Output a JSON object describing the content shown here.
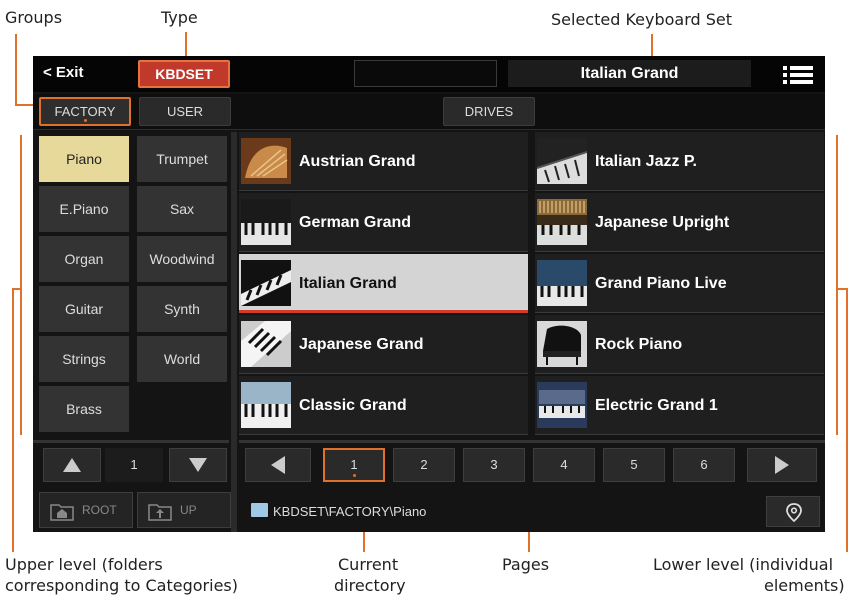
{
  "callouts": {
    "groups": "Groups",
    "type": "Type",
    "selected_set": "Selected Keyboard Set",
    "upper_level_1": "Upper level (folders",
    "upper_level_2": "corresponding to Categories)",
    "current_dir_1": "Current",
    "current_dir_2": "directory",
    "pages": "Pages",
    "lower_level_1": "Lower level (individual",
    "lower_level_2": "elements)"
  },
  "topbar": {
    "exit_label": "< Exit",
    "type_label": "KBDSET",
    "selected_set": "Italian Grand",
    "menu_icon": "hamburger-icon"
  },
  "groups": {
    "factory": "FACTORY",
    "user": "USER",
    "drives": "DRIVES"
  },
  "categories": [
    {
      "label": "Piano",
      "selected": true
    },
    {
      "label": "Trumpet"
    },
    {
      "label": "E.Piano"
    },
    {
      "label": "Sax"
    },
    {
      "label": "Organ"
    },
    {
      "label": "Woodwind"
    },
    {
      "label": "Guitar"
    },
    {
      "label": "Synth"
    },
    {
      "label": "Strings"
    },
    {
      "label": "World"
    },
    {
      "label": "Brass"
    }
  ],
  "elements": [
    {
      "label": "Austrian Grand"
    },
    {
      "label": "Italian Jazz P."
    },
    {
      "label": "German Grand"
    },
    {
      "label": "Japanese Upright"
    },
    {
      "label": "Italian Grand",
      "selected": true
    },
    {
      "label": "Grand Piano Live"
    },
    {
      "label": "Japanese Grand"
    },
    {
      "label": "Rock Piano"
    },
    {
      "label": "Classic Grand"
    },
    {
      "label": "Electric Grand 1"
    }
  ],
  "category_paging": {
    "page": "1",
    "up_icon": "triangle-up-icon",
    "down_icon": "triangle-down-icon"
  },
  "element_pages": [
    "1",
    "2",
    "3",
    "4",
    "5",
    "6"
  ],
  "current_page": "1",
  "nav": {
    "root_label": "ROOT",
    "up_label": "UP",
    "current_directory": "KBDSET\\FACTORY\\Piano",
    "location_icon": "location-pin-icon"
  },
  "colors": {
    "accent": "#e0702a",
    "type_red": "#c0392b",
    "selected_category": "#e6d99a",
    "selected_element": "#d4d4d4"
  }
}
